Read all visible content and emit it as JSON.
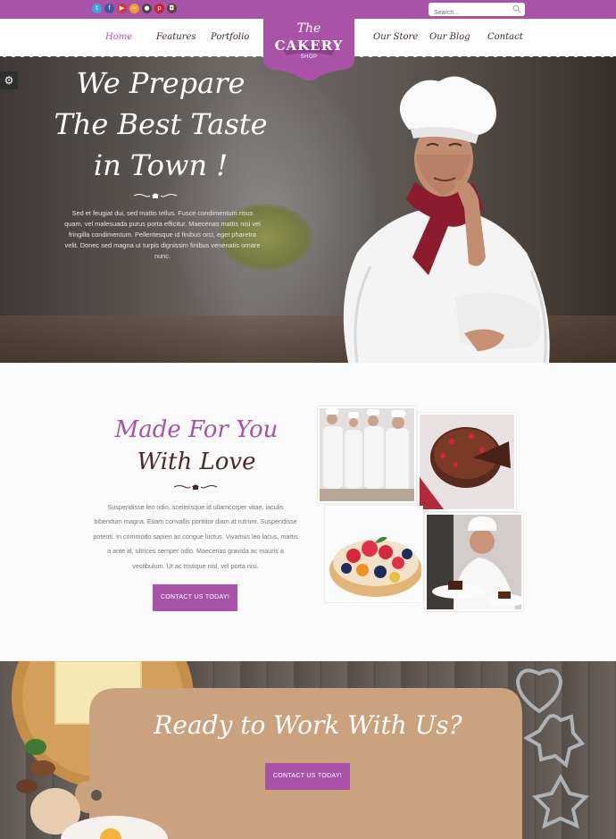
{
  "topbar": {
    "social_icons": [
      {
        "name": "twitter-icon",
        "glyph": "t",
        "color": "#35a8e0"
      },
      {
        "name": "facebook-icon",
        "glyph": "f",
        "color": "#3b5998"
      },
      {
        "name": "youtube-icon",
        "glyph": "▶",
        "color": "#d43a33"
      },
      {
        "name": "rss-icon",
        "glyph": "≈",
        "color": "#f29a23"
      },
      {
        "name": "flickr-icon",
        "glyph": "●",
        "color": "#444"
      },
      {
        "name": "pinterest-icon",
        "glyph": "p",
        "color": "#cb2027"
      },
      {
        "name": "instagram-icon",
        "glyph": "◘",
        "color": "#5b4636"
      }
    ],
    "search_placeholder": "Search..."
  },
  "nav": {
    "items": [
      {
        "label": "Home",
        "active": true
      },
      {
        "label": "Features",
        "active": false
      },
      {
        "label": "Portfolio",
        "active": false
      },
      {
        "label": "Our Store",
        "active": false
      },
      {
        "label": "Our Blog",
        "active": false
      },
      {
        "label": "Contact",
        "active": false
      }
    ],
    "logo": {
      "the": "The",
      "name": "CAKERY",
      "shop": "SHOP"
    }
  },
  "hero": {
    "title_lines": [
      "We Prepare",
      "The Best Taste",
      "in Town !"
    ],
    "text": "Sed et feugiat dui, sed mattis tellus. Fusce condimentum risus quam, vel malesuada purus porta efficitur. Maecenas mattis nisi vel fringilla condimentum. Pellentesque id finibus orci, eget pharetra velit. Donec sed magna ut turpis dignissim finibus venenatis ornare nunc."
  },
  "about": {
    "title_line1": "Made For You",
    "title_line2": "With Love",
    "text": "Suspendisse leo odio, scelerisque id ullamcorper vitae, iaculis bibendum magna. Etiam convallis porttitor diam at rutrum. Suspendisse potenti. In commodo sapien ac congue luctus. Vivamus leo lacus, mattis a ante id, ultrices semper odio. Maecenas gravida ac mauris a vestibulum. Ut ac tristique nisl, vel porta nisi.",
    "button": "CONTACT US TODAY!"
  },
  "cta": {
    "title": "Ready to Work With Us?",
    "button": "CONTACT US TODAY!"
  },
  "colors": {
    "accent": "#a953a8",
    "dark_text": "#4a2a2a"
  }
}
